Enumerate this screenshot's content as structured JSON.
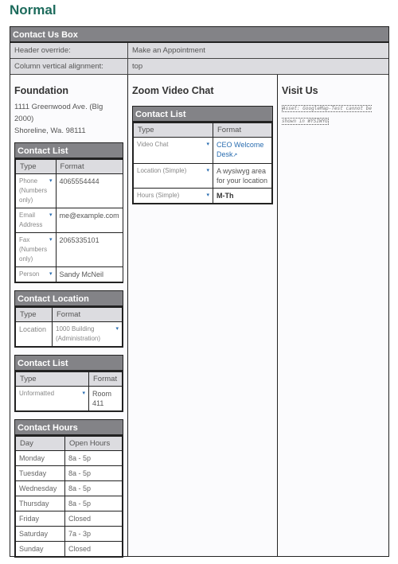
{
  "title": "Normal",
  "box_title": "Contact Us Box",
  "props": [
    {
      "label": "Header override:",
      "value": "Make an Appointment"
    },
    {
      "label": "Column vertical alignment:",
      "value": "top"
    }
  ],
  "col1": {
    "heading": "Foundation",
    "address": [
      "1111 Greenwood Ave. (Blg 2000)",
      "Shoreline, Wa. 98111"
    ],
    "contact_list": {
      "title": "Contact List",
      "headers": [
        "Type",
        "Format"
      ],
      "rows": [
        {
          "type": "Phone (Numbers only)",
          "value": "4065554444"
        },
        {
          "type": "Email Address",
          "value": "me@example.com"
        },
        {
          "type": "Fax (Numbers only)",
          "value": "2065335101"
        },
        {
          "type": "Person",
          "value": "Sandy McNeil"
        }
      ]
    },
    "contact_location": {
      "title": "Contact Location",
      "headers": [
        "Type",
        "Format"
      ],
      "rows": [
        {
          "type": "Location",
          "value": "1000 Building (Administration)"
        }
      ]
    },
    "contact_list2": {
      "title": "Contact List",
      "headers": [
        "Type",
        "Format"
      ],
      "rows": [
        {
          "type": "Unformatted",
          "value": "Room 411"
        }
      ]
    },
    "contact_hours": {
      "title": "Contact Hours",
      "headers": [
        "Day",
        "Open Hours"
      ],
      "rows": [
        {
          "day": "Monday",
          "hours": "8a - 5p"
        },
        {
          "day": "Tuesday",
          "hours": "8a - 5p"
        },
        {
          "day": "Wednesday",
          "hours": "8a - 5p"
        },
        {
          "day": "Thursday",
          "hours": "8a - 5p"
        },
        {
          "day": "Friday",
          "hours": "Closed"
        },
        {
          "day": "Saturday",
          "hours": "7a - 3p"
        },
        {
          "day": "Sunday",
          "hours": "Closed"
        }
      ]
    }
  },
  "col2": {
    "heading": "Zoom Video Chat",
    "contact_list": {
      "title": "Contact List",
      "headers": [
        "Type",
        "Format"
      ],
      "rows": [
        {
          "type": "Video Chat",
          "value": "CEO Welcome Desk"
        },
        {
          "type": "Location (Simple)",
          "value": "A wysiwyg area for your location"
        },
        {
          "type": "Hours (Simple)",
          "value": "M-Th"
        }
      ]
    }
  },
  "col3": {
    "heading": "Visit Us",
    "map_notice": "Asset: GoogleMap-Test cannot be shown in WYSIWYG"
  },
  "icons": {
    "dropdown": "▾",
    "external": "↗"
  }
}
